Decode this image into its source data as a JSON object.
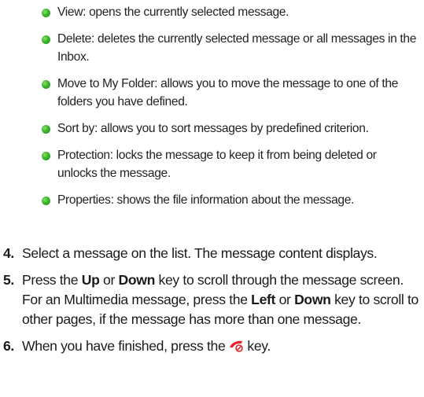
{
  "options": [
    {
      "text": "View: opens the currently selected message."
    },
    {
      "text": "Delete: deletes the currently selected message or all messages in the Inbox."
    },
    {
      "text": "Move to My Folder: allows you to move the message to one of the folders you have defined."
    },
    {
      "text": "Sort by: allows you to sort messages by predefined criterion."
    },
    {
      "text": "Protection: locks the message to keep it from being deleted or unlocks the message."
    },
    {
      "text": "Properties: shows the file information about the message."
    }
  ],
  "steps": [
    {
      "number": "4.",
      "text": "Select a message on the list. The message content displays."
    },
    {
      "number": "5.",
      "parts": {
        "a": "Press the ",
        "b": "Up",
        "c": " or ",
        "d": "Down",
        "e": " key to scroll through the message screen. For an Multimedia message, press the ",
        "f": "Left",
        "g": " or ",
        "h": "Down",
        "i": " key to scroll to other pages, if the message has more than one message."
      }
    },
    {
      "number": "6.",
      "before_icon": "When you have finished, press the",
      "icon": "end-call-icon",
      "after_icon": "key."
    }
  ],
  "colors": {
    "bullet": "#3bb52b",
    "end_key_icon": "#e8232a"
  }
}
